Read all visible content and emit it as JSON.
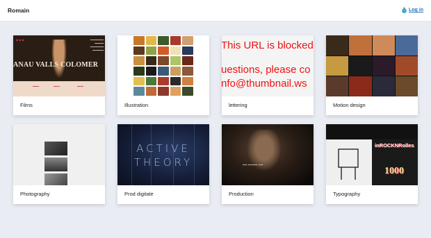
{
  "header": {
    "brand": "Romain",
    "login_label": "Log in"
  },
  "cards": [
    {
      "label": "Films"
    },
    {
      "label": "Illustration"
    },
    {
      "label": "lettering"
    },
    {
      "label": "Motion design"
    },
    {
      "label": "Photography"
    },
    {
      "label": "Prod digitale"
    },
    {
      "label": "Production"
    },
    {
      "label": "Typography"
    }
  ],
  "thumbs": {
    "films_name": "ANAU VALLS COLOMER",
    "blocked_lines": [
      "This URL is blocked",
      "uestions, please co",
      "nfo@thumbnail.ws"
    ],
    "prod_lines": [
      "ACTIVE",
      "THEORY"
    ],
    "typo_title": "inROCKNRolles",
    "typo_number": "1000"
  },
  "colors": {
    "accent": "#2a6fbb",
    "background": "#e9ecf2",
    "blocked_text": "#e11111"
  }
}
